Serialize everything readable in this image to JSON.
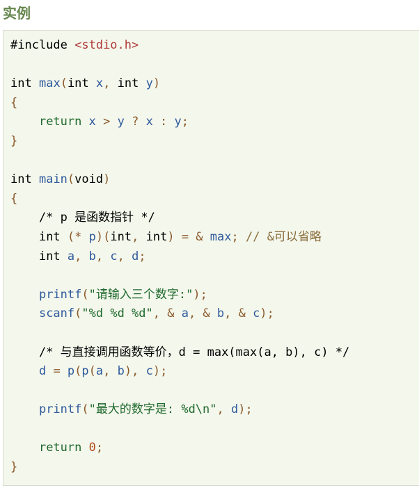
{
  "heading": "实例",
  "code_lines": [
    [
      {
        "t": "#include ",
        "k": "pp"
      },
      {
        "t": "<stdio.h>",
        "k": "inc"
      }
    ],
    [],
    [
      {
        "t": "int",
        "k": "ty"
      },
      {
        "t": " ",
        "k": "pl"
      },
      {
        "t": "max",
        "k": "fn"
      },
      {
        "t": "(",
        "k": "pun"
      },
      {
        "t": "int",
        "k": "ty"
      },
      {
        "t": " ",
        "k": "pl"
      },
      {
        "t": "x",
        "k": "id"
      },
      {
        "t": ",",
        "k": "pun"
      },
      {
        "t": " ",
        "k": "pl"
      },
      {
        "t": "int",
        "k": "ty"
      },
      {
        "t": " ",
        "k": "pl"
      },
      {
        "t": "y",
        "k": "id"
      },
      {
        "t": ")",
        "k": "pun"
      }
    ],
    [
      {
        "t": "{",
        "k": "pun"
      }
    ],
    [
      {
        "t": "    ",
        "k": "pl"
      },
      {
        "t": "return",
        "k": "kw"
      },
      {
        "t": " ",
        "k": "pl"
      },
      {
        "t": "x",
        "k": "id"
      },
      {
        "t": " > ",
        "k": "op"
      },
      {
        "t": "y",
        "k": "id"
      },
      {
        "t": " ? ",
        "k": "op"
      },
      {
        "t": "x",
        "k": "id"
      },
      {
        "t": " : ",
        "k": "op"
      },
      {
        "t": "y",
        "k": "id"
      },
      {
        "t": ";",
        "k": "pun"
      }
    ],
    [
      {
        "t": "}",
        "k": "pun"
      }
    ],
    [],
    [
      {
        "t": "int",
        "k": "ty"
      },
      {
        "t": " ",
        "k": "pl"
      },
      {
        "t": "main",
        "k": "fn"
      },
      {
        "t": "(",
        "k": "pun"
      },
      {
        "t": "void",
        "k": "ty"
      },
      {
        "t": ")",
        "k": "pun"
      }
    ],
    [
      {
        "t": "{",
        "k": "pun"
      }
    ],
    [
      {
        "t": "    ",
        "k": "pl"
      },
      {
        "t": "/* p 是函数指针 */",
        "k": "cmb"
      }
    ],
    [
      {
        "t": "    ",
        "k": "pl"
      },
      {
        "t": "int",
        "k": "ty"
      },
      {
        "t": " ",
        "k": "pl"
      },
      {
        "t": "(",
        "k": "pun"
      },
      {
        "t": "*",
        "k": "op"
      },
      {
        "t": " ",
        "k": "pl"
      },
      {
        "t": "p",
        "k": "id"
      },
      {
        "t": ")(",
        "k": "pun"
      },
      {
        "t": "int",
        "k": "ty"
      },
      {
        "t": ",",
        "k": "pun"
      },
      {
        "t": " ",
        "k": "pl"
      },
      {
        "t": "int",
        "k": "ty"
      },
      {
        "t": ")",
        "k": "pun"
      },
      {
        "t": " = & ",
        "k": "op"
      },
      {
        "t": "max",
        "k": "id"
      },
      {
        "t": ";",
        "k": "pun"
      },
      {
        "t": " // &可以省略",
        "k": "cm"
      }
    ],
    [
      {
        "t": "    ",
        "k": "pl"
      },
      {
        "t": "int",
        "k": "ty"
      },
      {
        "t": " ",
        "k": "pl"
      },
      {
        "t": "a",
        "k": "id"
      },
      {
        "t": ", ",
        "k": "pun"
      },
      {
        "t": "b",
        "k": "id"
      },
      {
        "t": ", ",
        "k": "pun"
      },
      {
        "t": "c",
        "k": "id"
      },
      {
        "t": ", ",
        "k": "pun"
      },
      {
        "t": "d",
        "k": "id"
      },
      {
        "t": ";",
        "k": "pun"
      }
    ],
    [],
    [
      {
        "t": "    ",
        "k": "pl"
      },
      {
        "t": "printf",
        "k": "fn"
      },
      {
        "t": "(",
        "k": "pun"
      },
      {
        "t": "\"请输入三个数字:\"",
        "k": "str"
      },
      {
        "t": ");",
        "k": "pun"
      }
    ],
    [
      {
        "t": "    ",
        "k": "pl"
      },
      {
        "t": "scanf",
        "k": "fn"
      },
      {
        "t": "(",
        "k": "pun"
      },
      {
        "t": "\"%d %d %d\"",
        "k": "str"
      },
      {
        "t": ", & ",
        "k": "op"
      },
      {
        "t": "a",
        "k": "id"
      },
      {
        "t": ", & ",
        "k": "op"
      },
      {
        "t": "b",
        "k": "id"
      },
      {
        "t": ", & ",
        "k": "op"
      },
      {
        "t": "c",
        "k": "id"
      },
      {
        "t": ");",
        "k": "pun"
      }
    ],
    [],
    [
      {
        "t": "    ",
        "k": "pl"
      },
      {
        "t": "/* 与直接调用函数等价，d = max(max(a, b), c) */",
        "k": "cmb"
      }
    ],
    [
      {
        "t": "    ",
        "k": "pl"
      },
      {
        "t": "d",
        "k": "id"
      },
      {
        "t": " = ",
        "k": "op"
      },
      {
        "t": "p",
        "k": "fn"
      },
      {
        "t": "(",
        "k": "pun"
      },
      {
        "t": "p",
        "k": "fn"
      },
      {
        "t": "(",
        "k": "pun"
      },
      {
        "t": "a",
        "k": "id"
      },
      {
        "t": ", ",
        "k": "pun"
      },
      {
        "t": "b",
        "k": "id"
      },
      {
        "t": "), ",
        "k": "pun"
      },
      {
        "t": "c",
        "k": "id"
      },
      {
        "t": ");",
        "k": "pun"
      }
    ],
    [],
    [
      {
        "t": "    ",
        "k": "pl"
      },
      {
        "t": "printf",
        "k": "fn"
      },
      {
        "t": "(",
        "k": "pun"
      },
      {
        "t": "\"最大的数字是: %d\\n\"",
        "k": "str"
      },
      {
        "t": ", ",
        "k": "pun"
      },
      {
        "t": "d",
        "k": "id"
      },
      {
        "t": ");",
        "k": "pun"
      }
    ],
    [],
    [
      {
        "t": "    ",
        "k": "pl"
      },
      {
        "t": "return",
        "k": "kw"
      },
      {
        "t": " ",
        "k": "pl"
      },
      {
        "t": "0",
        "k": "num"
      },
      {
        "t": ";",
        "k": "pun"
      }
    ],
    [
      {
        "t": "}",
        "k": "pun"
      }
    ]
  ]
}
